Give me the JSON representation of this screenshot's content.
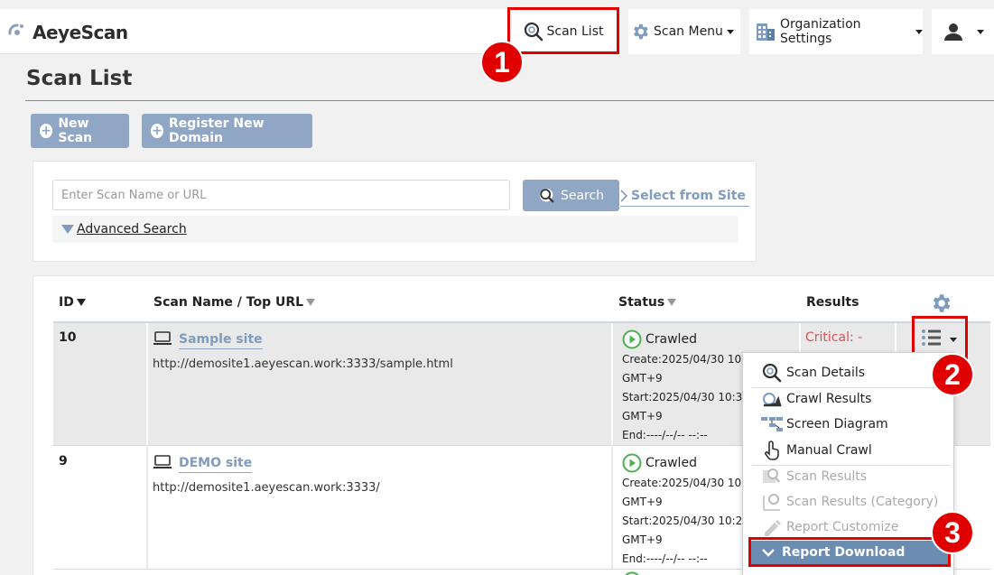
{
  "app": {
    "name": "AeyeScan"
  },
  "nav": {
    "scan_list": "Scan List",
    "scan_menu": "Scan Menu",
    "org_settings": "Organization Settings"
  },
  "page": {
    "title": "Scan List",
    "new_scan": "New Scan",
    "register_domain": "Register New Domain"
  },
  "search": {
    "placeholder": "Enter Scan Name or URL",
    "button": "Search",
    "select_site": "Select from Site",
    "advanced": "Advanced Search"
  },
  "table": {
    "headers": {
      "id": "ID",
      "name": "Scan Name / Top URL",
      "status": "Status",
      "results": "Results"
    },
    "rows": [
      {
        "id": "10",
        "name": "Sample site",
        "url": "http://demosite1.aeyescan.work:3333/sample.html",
        "status": "Crawled",
        "create": "Create:2025/04/30 10",
        "tz1": "GMT+9",
        "start": "Start:2025/04/30 10:3",
        "tz2": "GMT+9",
        "end": "End:----/--/-- --:--",
        "result": "Critical: -"
      },
      {
        "id": "9",
        "name": "DEMO site",
        "url": "http://demosite1.aeyescan.work:3333/",
        "status": "Crawled",
        "create": "Create:2025/04/30 10",
        "tz1": "GMT+9",
        "start": "Start:2025/04/30 10:2",
        "tz2": "GMT+9",
        "end": "End:----/--/-- --:--"
      }
    ]
  },
  "dropdown": {
    "items": [
      "Scan Details",
      "Crawl Results",
      "Screen Diagram",
      "Manual Crawl",
      "Scan Results",
      "Scan Results (Category)",
      "Report Customize",
      "Report Download"
    ]
  },
  "annotations": {
    "step1": "1",
    "step2": "2",
    "step3": "3"
  },
  "colors": {
    "accent": "#8fa7c4",
    "highlight": "#e00000",
    "critical": "#d9534f",
    "status_green": "#4caf50"
  }
}
